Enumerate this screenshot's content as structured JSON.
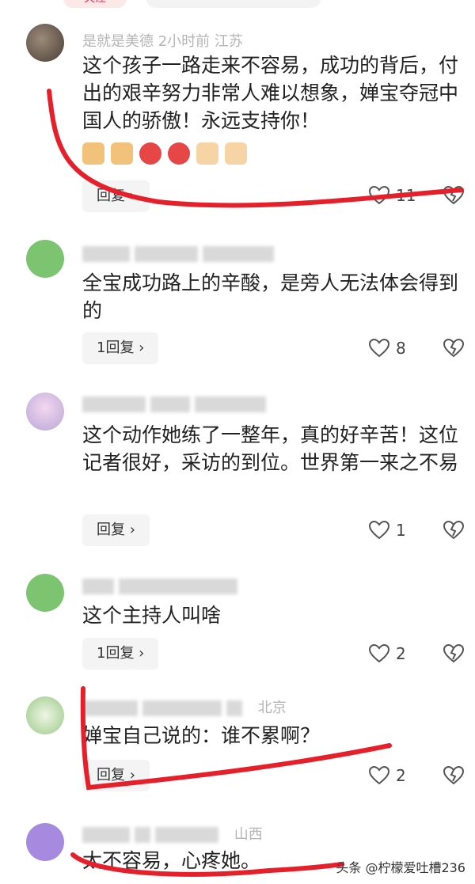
{
  "top": {
    "follow_label": "关注"
  },
  "comments": [
    {
      "meta_text": "是就是美德  2小时前  江苏",
      "text": "这个孩子一路走来不容易，成功的背后，付出的艰辛努力非常人难以想象，婵宝夺冠中国人的骄傲！永远支持你！",
      "reply_label": "回复 ›",
      "likes": "11"
    },
    {
      "meta_text": "",
      "text": "全宝成功路上的辛酸，是旁人无法体会得到的",
      "reply_label": "1回复 ›",
      "likes": "8"
    },
    {
      "meta_text": "",
      "text": "这个动作她练了一整年，真的好辛苦！这位记者很好，采访的到位。世界第一来之不易",
      "reply_label": "回复 ›",
      "likes": "1"
    },
    {
      "meta_text": "",
      "text": "这个主持人叫啥",
      "reply_label": "1回复 ›",
      "likes": "2"
    },
    {
      "meta_text": "北京",
      "text": "婵宝自己说的：谁不累啊？",
      "reply_label": "回复 ›",
      "likes": "2"
    },
    {
      "meta_text": "山西",
      "text": "太不容易，心疼她。",
      "reply_label": "",
      "likes": ""
    }
  ],
  "watermark": "头条 @柠檬爱吐槽236",
  "colors": {
    "accent": "#ff2c55",
    "annotation_red": "#e5202a"
  },
  "icons": [
    "heart-icon",
    "dislike-broken-heart-icon",
    "thumbs-up-emoji",
    "rose-emoji",
    "praying-hands-emoji"
  ]
}
